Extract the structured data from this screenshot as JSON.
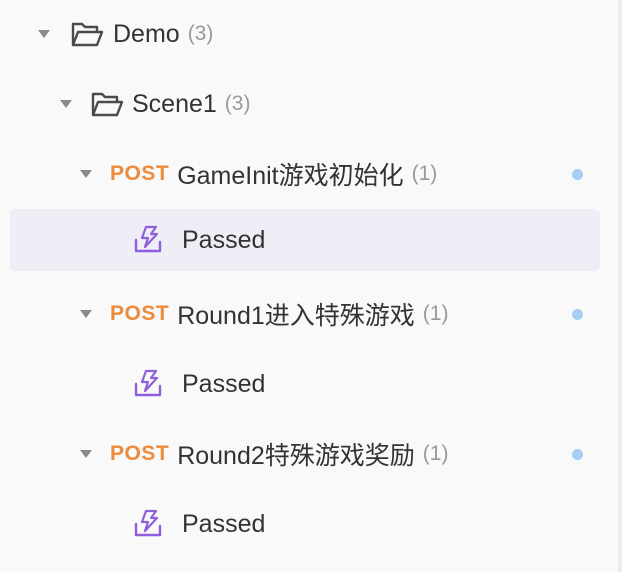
{
  "tree": {
    "folder": {
      "label": "Demo",
      "count": "(3)"
    },
    "subfolder": {
      "label": "Scene1",
      "count": "(3)"
    },
    "apis": [
      {
        "method": "POST",
        "label": "GameInit游戏初始化",
        "count": "(1)",
        "case_label": "Passed"
      },
      {
        "method": "POST",
        "label": "Round1进入特殊游戏",
        "count": "(1)",
        "case_label": "Passed"
      },
      {
        "method": "POST",
        "label": "Round2特殊游戏奖励",
        "count": "(1)",
        "case_label": "Passed"
      }
    ]
  },
  "colors": {
    "method_post": "#ee8b3b",
    "case_icon": "#8f5fdc",
    "status_dot": "#a8cdf3",
    "selected_row": "#efedf6"
  }
}
